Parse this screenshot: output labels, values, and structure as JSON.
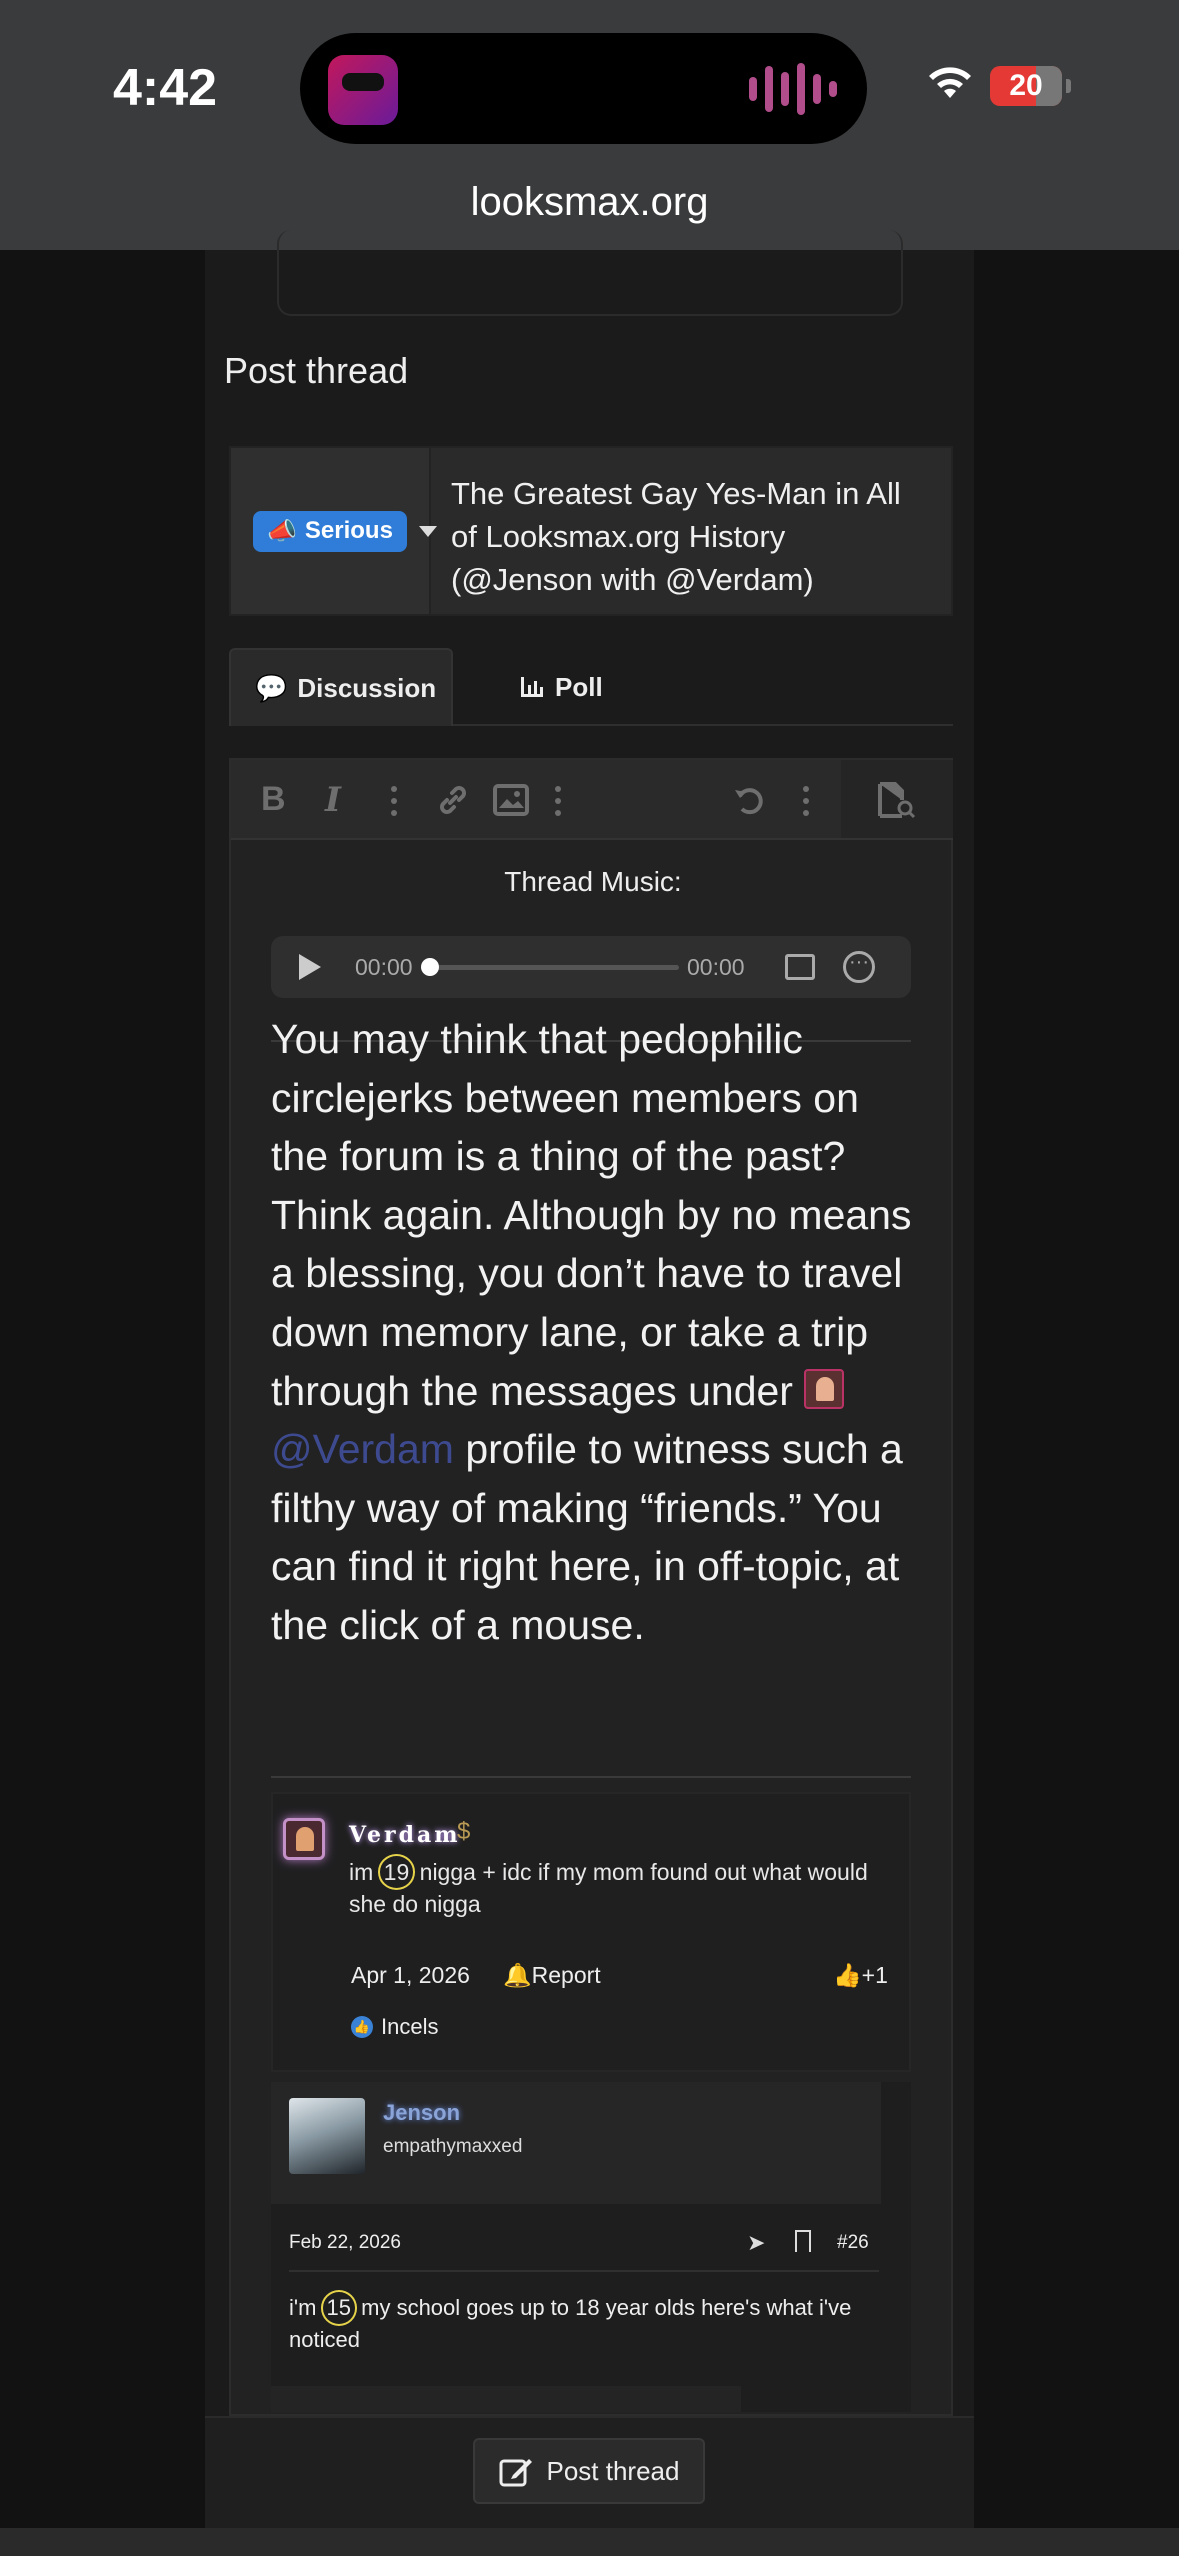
{
  "status": {
    "time": "4:42",
    "battery": "20"
  },
  "browser": {
    "url": "looksmax.org"
  },
  "page": {
    "section_title": "Post thread"
  },
  "thread": {
    "prefix": "Serious",
    "title": "The Greatest Gay Yes-Man in All of Looksmax.org History (@Jenson with @Verdam)"
  },
  "tabs": [
    {
      "label": "Discussion"
    },
    {
      "label": "Poll"
    }
  ],
  "editor": {
    "music_label": "Thread Music:",
    "player": {
      "current": "00:00",
      "duration": "00:00",
      "progress": 0
    },
    "body_before": "You may think that pedophilic circlejerks between members on the forum is a thing of the past? Think again. Although by no means a blessing, you don’t have to travel down memory lane, or take a trip through the messages under ",
    "mention": "@Verdam",
    "body_after": " profile to witness such a filthy way of making “friends.” You can find it right here, in off-topic, at the click of a mouse."
  },
  "screenshot1": {
    "username": "Verdam",
    "message_pre": "im ",
    "message_age": "19",
    "message_post": " nigga + idc if my mom found out what would she do nigga",
    "date": "Apr 1, 2026",
    "report": "Report",
    "likes": "+1",
    "reaction_user": "Incels"
  },
  "screenshot2": {
    "username": "Jenson",
    "subtitle": "empathymaxxed",
    "date": "Feb 22, 2026",
    "post_number": "#26",
    "message_pre": "i'm ",
    "message_age": "15",
    "message_post": " my school goes up to 18 year olds here's what i've noticed"
  },
  "footer": {
    "post_button": "Post thread"
  },
  "colors": {
    "prefix_badge": "#2f7dd8",
    "mention": "#3d4a8f",
    "highlight_circle": "#e6d34a"
  }
}
